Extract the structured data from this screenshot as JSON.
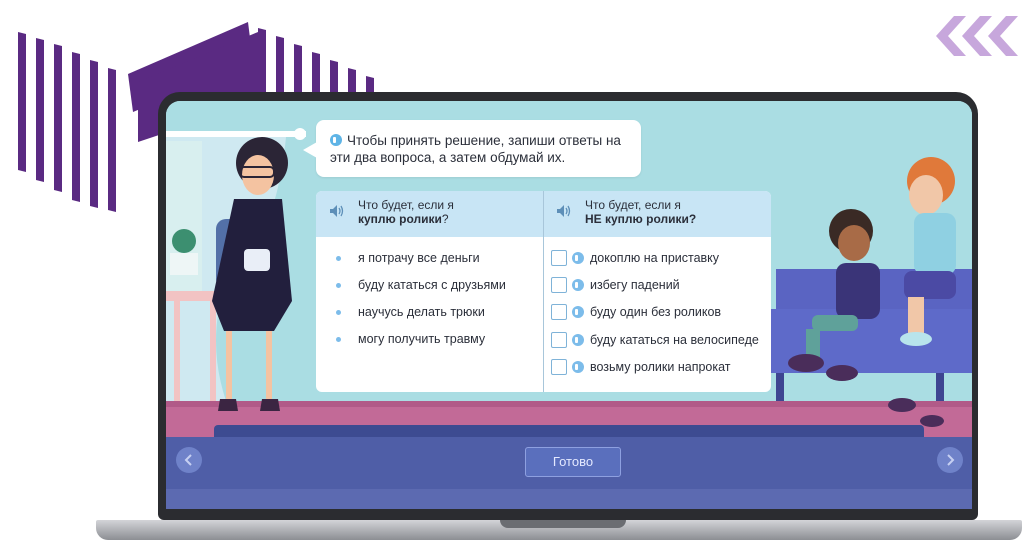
{
  "bubble": {
    "text": "Чтобы принять решение, запиши ответы на эти два вопроса, а затем обдумай их."
  },
  "table": {
    "left_header": {
      "line1": "Что будет, если я",
      "bold": "куплю ролики",
      "suffix": "?"
    },
    "right_header": {
      "line1": "Что будет, если я",
      "bold": "НЕ куплю ролики?"
    },
    "left_items": [
      "я потрачу все деньги",
      "буду кататься с друзьями",
      "научусь делать трюки",
      "могу получить травму"
    ],
    "right_items": [
      "докоплю на приставку",
      "избегу падений",
      "буду один без роликов",
      "буду кататься на велосипеде",
      "возьму ролики напрокат"
    ]
  },
  "controls": {
    "done_label": "Готово"
  },
  "colors": {
    "accent": "#5fb4e6",
    "decor_purple": "#5a2a82",
    "bar_blue": "#4f5ea7"
  },
  "icons": {
    "speaker": "speaker-icon",
    "prev": "chevron-left-icon",
    "next": "chevron-right-icon"
  }
}
